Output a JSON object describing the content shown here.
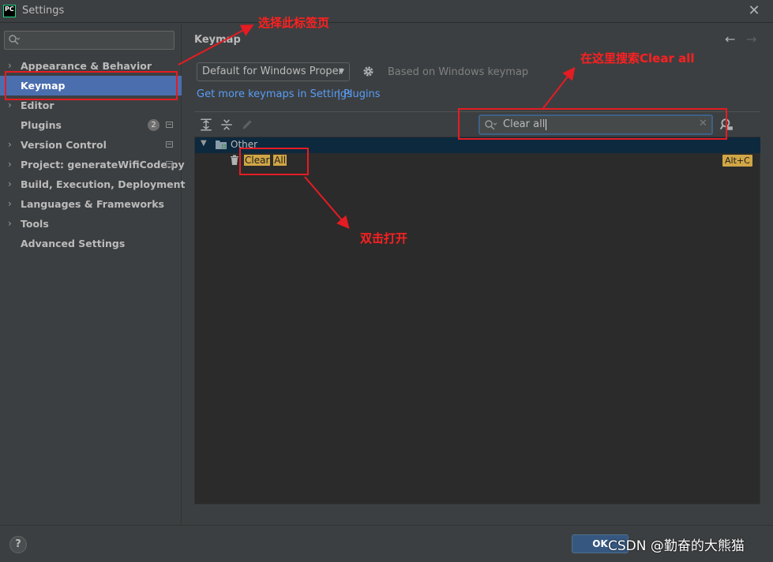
{
  "window": {
    "title": "Settings",
    "logo_text": "PC",
    "close_glyph": "✕"
  },
  "sidebar": {
    "search_value": "",
    "items": [
      {
        "label": "Appearance & Behavior",
        "chevron": "›",
        "selected": false
      },
      {
        "label": "Keymap",
        "chevron": "",
        "selected": true
      },
      {
        "label": "Editor",
        "chevron": "›",
        "selected": false
      },
      {
        "label": "Plugins",
        "chevron": "",
        "badge": "2",
        "selected": false
      },
      {
        "label": "Version Control",
        "chevron": "›",
        "selected": false
      },
      {
        "label": "Project: generateWifiCode.py",
        "chevron": "›",
        "selected": false
      },
      {
        "label": "Build, Execution, Deployment",
        "chevron": "›",
        "selected": false
      },
      {
        "label": "Languages & Frameworks",
        "chevron": "›",
        "selected": false
      },
      {
        "label": "Tools",
        "chevron": "›",
        "selected": false
      },
      {
        "label": "Advanced Settings",
        "chevron": "",
        "selected": false
      }
    ]
  },
  "main": {
    "title": "Keymap",
    "back_glyph": "←",
    "forward_glyph": "→",
    "keymap_select": "Default for Windows Proper",
    "based_on": "Based on Windows keymap",
    "links": {
      "more_keymaps": "Get more keymaps in Settings",
      "separator": "|",
      "plugins": "Plugins"
    },
    "search": {
      "value": "Clear all",
      "clear_glyph": "✕"
    },
    "tree": {
      "group": "Other",
      "action_part1": "Clear",
      "action_part2": "All",
      "shortcut": "Alt+C"
    }
  },
  "footer": {
    "help": "?",
    "ok": "OK",
    "watermark": "CSDN @勤奋的大熊猫"
  },
  "annotations": {
    "select_tab": "选择此标签页",
    "search_here": "在这里搜索Clear all",
    "double_click": "双击打开"
  },
  "colors": {
    "selection": "#4b6eaf",
    "highlight": "#d0a646",
    "annotation": "#e51c23",
    "link": "#589df6"
  }
}
